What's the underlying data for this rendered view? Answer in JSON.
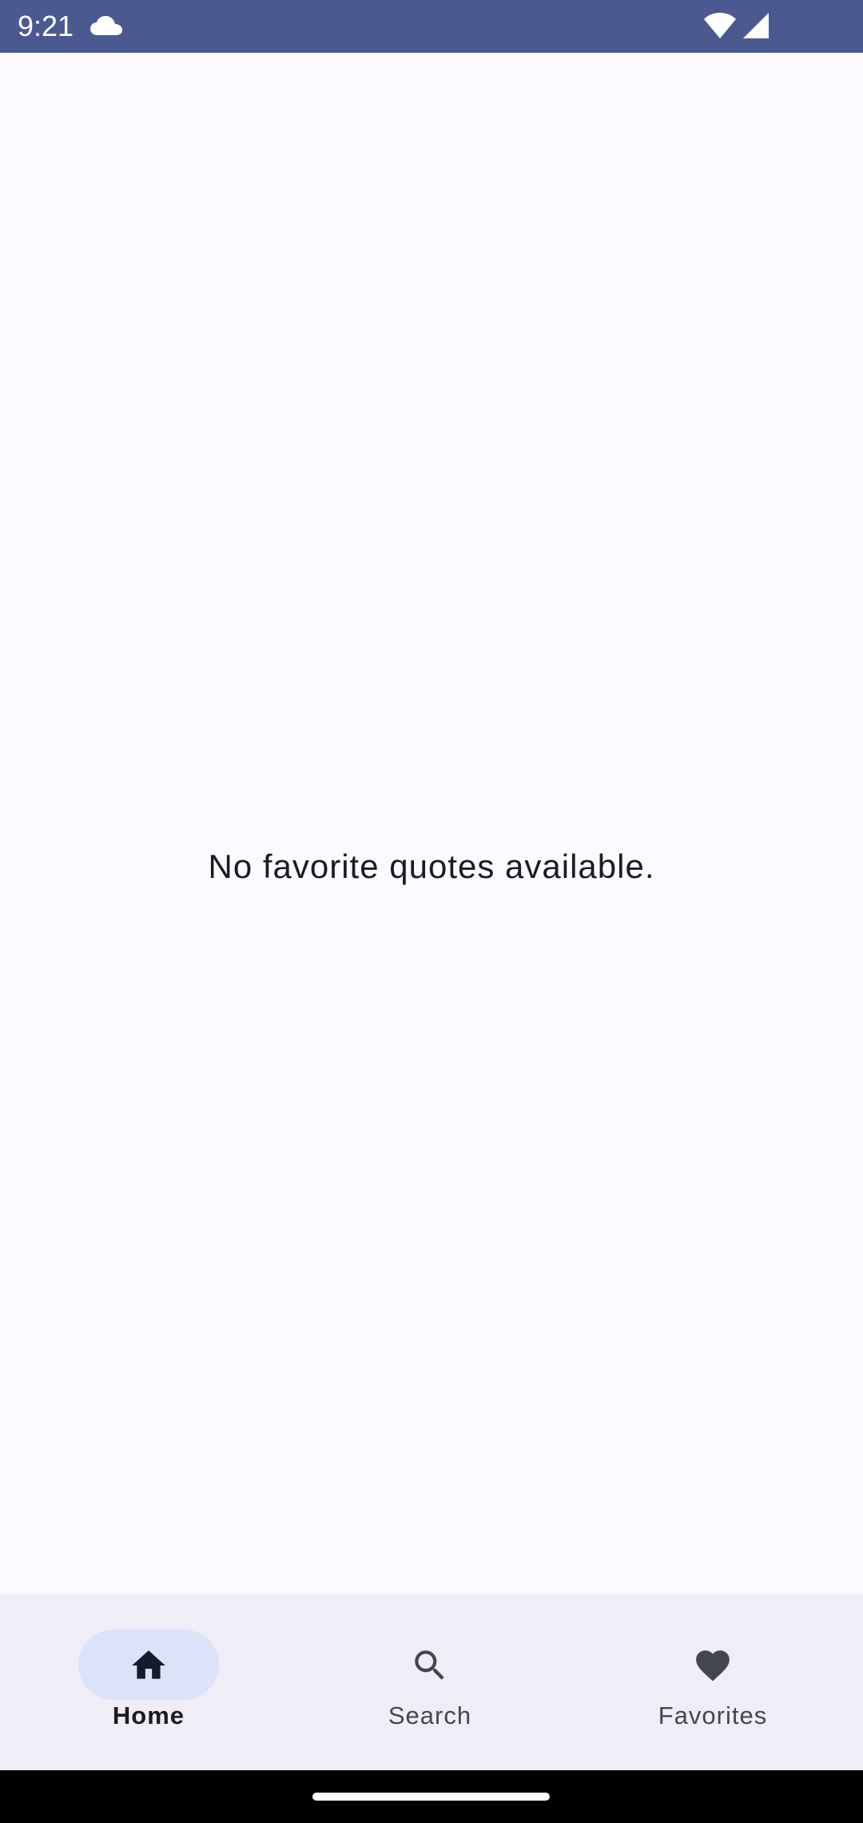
{
  "status_bar": {
    "time": "9:21",
    "icons": [
      "cloud-icon",
      "wifi-icon",
      "signal-icon"
    ],
    "background": "#4a5a91"
  },
  "main": {
    "empty_message": "No favorite quotes available."
  },
  "bottom_nav": {
    "items": [
      {
        "label": "Home",
        "icon": "home-icon",
        "active": true
      },
      {
        "label": "Search",
        "icon": "search-icon",
        "active": false
      },
      {
        "label": "Favorites",
        "icon": "heart-icon",
        "active": false
      }
    ],
    "indicator_color": "#dce2f8",
    "background": "#efedf6"
  }
}
